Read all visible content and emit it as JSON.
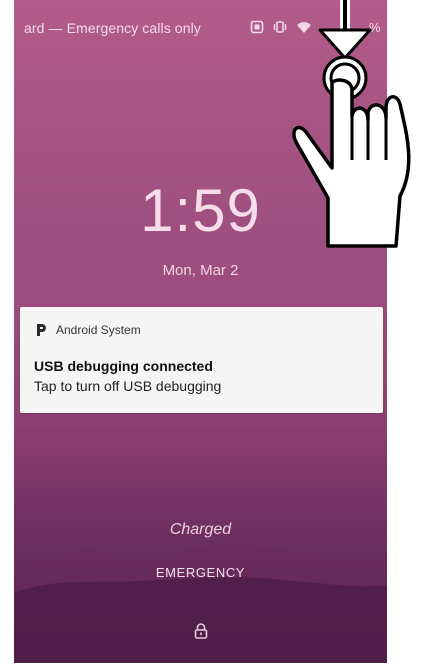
{
  "statusbar": {
    "carrier": "ard — Emergency calls only",
    "battery_text": "%"
  },
  "lockscreen": {
    "time": "1:59",
    "date": "Mon, Mar 2",
    "charging_status": "Charged",
    "emergency_label": "EMERGENCY"
  },
  "notification": {
    "app_name": "Android System",
    "app_icon": "p-icon",
    "title": "USB debugging connected",
    "text": "Tap to turn off USB debugging"
  },
  "colors": {
    "background_top": "#b45c8c",
    "background_bottom": "#4a1f44",
    "notification_bg": "#f5f5f5"
  },
  "icons": {
    "status_left": "screenshot-icon",
    "status_mid": "vibrate-icon",
    "status_right": "wifi-icon",
    "lock": "lock-icon",
    "hand": "hand-pointer-icon",
    "arrow": "arrow-down-icon"
  }
}
